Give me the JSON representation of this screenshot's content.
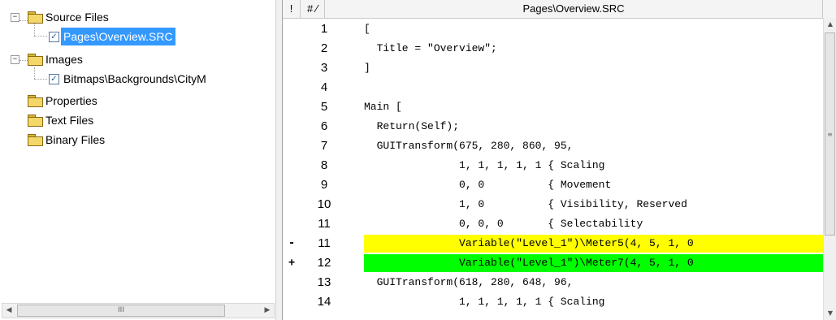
{
  "tree": {
    "items": [
      {
        "label": "Source Files",
        "expander": "−"
      },
      {
        "label": "Pages\\Overview.SRC",
        "checked": "✓"
      },
      {
        "label": "Images",
        "expander": "−"
      },
      {
        "label": "Bitmaps\\Backgrounds\\CityM",
        "checked": "✓"
      },
      {
        "label": "Properties"
      },
      {
        "label": "Text Files"
      },
      {
        "label": "Binary Files"
      }
    ],
    "hscroll": {
      "left": "◀",
      "right": "▶",
      "grip": "III"
    }
  },
  "code_view": {
    "header": {
      "mark": "!",
      "num": "# ∕",
      "title": "Pages\\Overview.SRC"
    },
    "rows": [
      {
        "mark": "",
        "num": "1",
        "code": "["
      },
      {
        "mark": "",
        "num": "2",
        "code": "  Title = \"Overview\";"
      },
      {
        "mark": "",
        "num": "3",
        "code": "]"
      },
      {
        "mark": "",
        "num": "4",
        "code": ""
      },
      {
        "mark": "",
        "num": "5",
        "code": "Main ["
      },
      {
        "mark": "",
        "num": "6",
        "code": "  Return(Self);"
      },
      {
        "mark": "",
        "num": "7",
        "code": "  GUITransform(675, 280, 860, 95,"
      },
      {
        "mark": "",
        "num": "8",
        "code": "               1, 1, 1, 1, 1 { Scaling"
      },
      {
        "mark": "",
        "num": "9",
        "code": "               0, 0          { Movement"
      },
      {
        "mark": "",
        "num": "10",
        "code": "               1, 0          { Visibility, Reserved"
      },
      {
        "mark": "",
        "num": "11",
        "code": "               0, 0, 0       { Selectability"
      },
      {
        "mark": "-",
        "num": "11",
        "code": "               Variable(\"Level_1\")\\Meter5(4, 5, 1, 0"
      },
      {
        "mark": "+",
        "num": "12",
        "code": "               Variable(\"Level_1\")\\Meter7(4, 5, 1, 0"
      },
      {
        "mark": "",
        "num": "13",
        "code": "  GUITransform(618, 280, 648, 96,"
      },
      {
        "mark": "",
        "num": "14",
        "code": "               1, 1, 1, 1, 1 { Scaling"
      }
    ],
    "vscroll": {
      "up": "▲",
      "down": "▼",
      "grip": "≡"
    }
  },
  "colors": {
    "removed_line": "#ffff00",
    "added_line": "#00ff00",
    "selection": "#3399ff"
  }
}
